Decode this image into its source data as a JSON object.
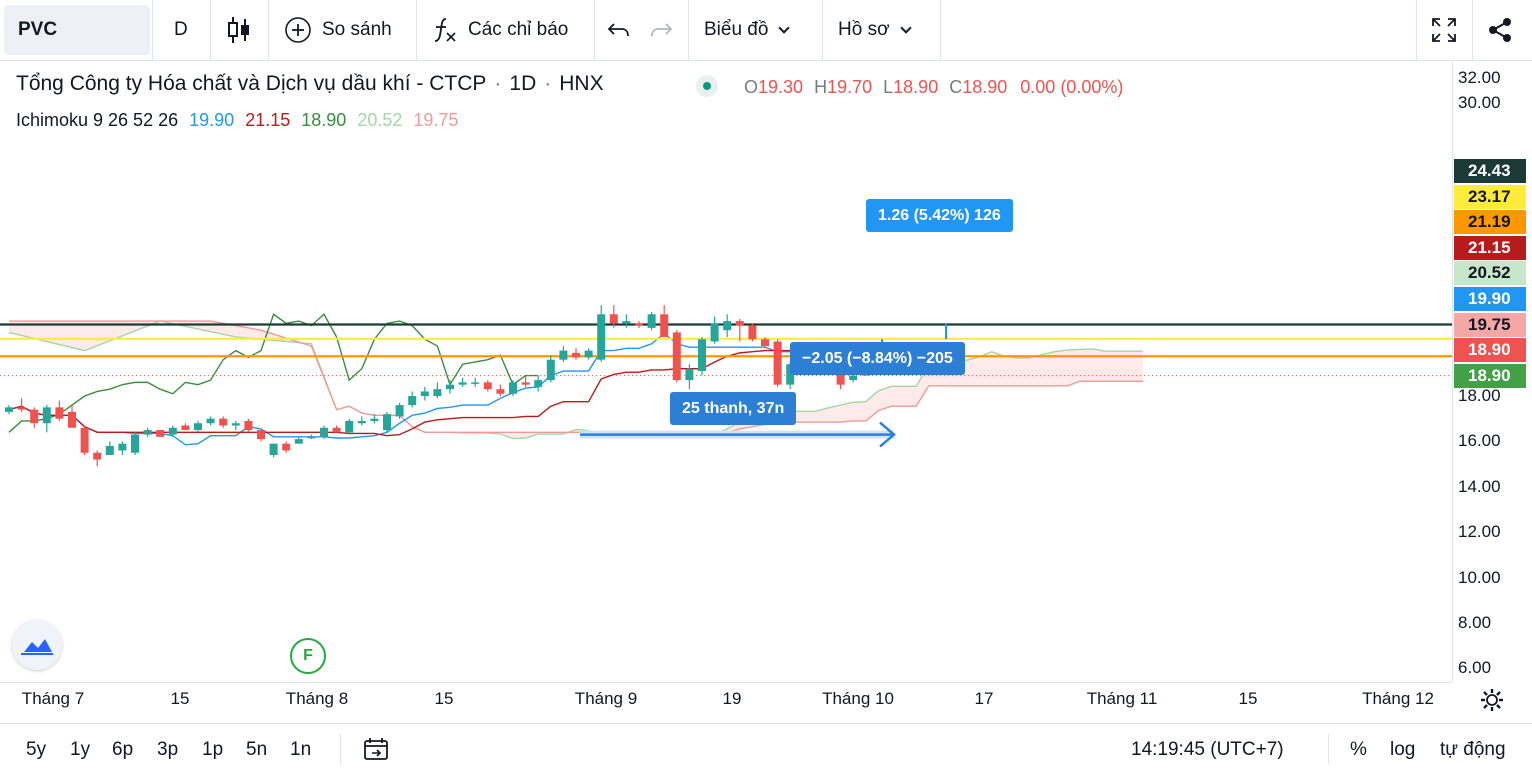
{
  "toolbar": {
    "symbol": "PVC",
    "interval": "D",
    "compare": "So sánh",
    "indicators": "Các chỉ báo",
    "chart_type": "Biểu đồ",
    "profile": "Hồ sơ"
  },
  "header": {
    "title": "Tổng Công ty Hóa chất và Dịch vụ dầu khí - CTCP",
    "interval": "1D",
    "exchange": "HNX",
    "ohlc": {
      "o_label": "O",
      "o": "19.30",
      "h_label": "H",
      "h": "19.70",
      "l_label": "L",
      "l": "18.90",
      "c_label": "C",
      "c": "18.90",
      "change": "0.00 (0.00%)"
    }
  },
  "indicator": {
    "name": "Ichimoku 9 26 52 26",
    "values": [
      "19.90",
      "21.15",
      "18.90",
      "20.52",
      "19.75"
    ],
    "colors": [
      "#2196f3",
      "#b71c1c",
      "#388e3c",
      "#a5d6a7",
      "#ef9a9a"
    ]
  },
  "yaxis": {
    "ticks": [
      "32.00",
      "30.00",
      "18.00",
      "16.00",
      "14.00",
      "12.00",
      "10.00",
      "8.00",
      "6.00"
    ]
  },
  "price_badges": [
    {
      "label": "24.43",
      "bg": "#1b3a36",
      "fg": "#ffffff",
      "value": 24.43
    },
    {
      "label": "23.17",
      "bg": "#ffeb3b",
      "fg": "#131722",
      "value": 23.17
    },
    {
      "label": "21.19",
      "bg": "#ff9800",
      "fg": "#131722",
      "value": 21.19
    },
    {
      "label": "21.15",
      "bg": "#b71c1c",
      "fg": "#ffffff",
      "value": 21.15
    },
    {
      "label": "20.52",
      "bg": "#c8e6c9",
      "fg": "#131722",
      "value": 20.52
    },
    {
      "label": "19.90",
      "bg": "#2196f3",
      "fg": "#ffffff",
      "value": 19.9
    },
    {
      "label": "19.75",
      "bg": "#f4a7a5",
      "fg": "#131722",
      "value": 19.75
    },
    {
      "label": "18.90",
      "bg": "#ef5350",
      "fg": "#ffffff",
      "value": 18.9
    },
    {
      "label": "18.90",
      "bg": "#43a047",
      "fg": "#ffffff",
      "value": 18.9
    }
  ],
  "xaxis": {
    "ticks": [
      "Tháng 7",
      "15",
      "Tháng 8",
      "15",
      "Tháng 9",
      "19",
      "Tháng 10",
      "17",
      "Tháng 11",
      "15",
      "Tháng 12"
    ]
  },
  "drawings": {
    "measure_up": "1.26 (5.42%) 126",
    "measure_down": "−2.05 (−8.84%) −205",
    "bars_range": "25 thanh, 37n",
    "f_marker": "F"
  },
  "bottom": {
    "ranges": [
      "5y",
      "1y",
      "6p",
      "3p",
      "1p",
      "5n",
      "1n"
    ],
    "time": "14:19:45 (UTC+7)",
    "percent": "%",
    "log": "log",
    "auto": "tự động"
  },
  "chart_data": {
    "type": "candlestick",
    "symbol": "PVC",
    "interval": "1D",
    "candles": [
      {
        "date": "2021-06-29",
        "o": 17.3,
        "h": 17.6,
        "l": 17.2,
        "c": 17.5
      },
      {
        "date": "2021-06-30",
        "o": 17.5,
        "h": 17.9,
        "l": 17.3,
        "c": 17.4
      },
      {
        "date": "2021-07-01",
        "o": 17.4,
        "h": 17.5,
        "l": 16.6,
        "c": 16.8
      },
      {
        "date": "2021-07-02",
        "o": 16.8,
        "h": 17.6,
        "l": 16.4,
        "c": 17.5
      },
      {
        "date": "2021-07-05",
        "o": 17.5,
        "h": 17.8,
        "l": 16.9,
        "c": 17.0
      },
      {
        "date": "2021-07-06",
        "o": 17.3,
        "h": 17.6,
        "l": 16.7,
        "c": 16.6
      },
      {
        "date": "2021-07-07",
        "o": 16.6,
        "h": 16.7,
        "l": 15.4,
        "c": 15.5
      },
      {
        "date": "2021-07-08",
        "o": 15.5,
        "h": 15.6,
        "l": 14.9,
        "c": 15.2
      },
      {
        "date": "2021-07-09",
        "o": 15.4,
        "h": 16.0,
        "l": 15.4,
        "c": 15.8
      },
      {
        "date": "2021-07-12",
        "o": 15.6,
        "h": 16.0,
        "l": 15.4,
        "c": 15.9
      },
      {
        "date": "2021-07-13",
        "o": 15.5,
        "h": 16.4,
        "l": 15.4,
        "c": 16.3
      },
      {
        "date": "2021-07-14",
        "o": 16.3,
        "h": 16.6,
        "l": 16.2,
        "c": 16.5
      },
      {
        "date": "2021-07-15",
        "o": 16.5,
        "h": 16.5,
        "l": 16.2,
        "c": 16.2
      },
      {
        "date": "2021-07-16",
        "o": 16.3,
        "h": 16.7,
        "l": 16.2,
        "c": 16.6
      },
      {
        "date": "2021-07-19",
        "o": 16.7,
        "h": 16.8,
        "l": 16.5,
        "c": 16.5
      },
      {
        "date": "2021-07-20",
        "o": 16.5,
        "h": 16.9,
        "l": 16.4,
        "c": 16.8
      },
      {
        "date": "2021-07-21",
        "o": 16.8,
        "h": 17.1,
        "l": 16.7,
        "c": 17.0
      },
      {
        "date": "2021-07-22",
        "o": 17.0,
        "h": 17.1,
        "l": 16.6,
        "c": 16.7
      },
      {
        "date": "2021-07-23",
        "o": 16.7,
        "h": 16.9,
        "l": 16.5,
        "c": 16.8
      },
      {
        "date": "2021-07-26",
        "o": 16.9,
        "h": 17.0,
        "l": 16.4,
        "c": 16.5
      },
      {
        "date": "2021-07-27",
        "o": 16.5,
        "h": 16.5,
        "l": 16.0,
        "c": 16.1
      },
      {
        "date": "2021-07-28",
        "o": 15.4,
        "h": 15.9,
        "l": 15.3,
        "c": 15.9
      },
      {
        "date": "2021-07-29",
        "o": 15.9,
        "h": 16.0,
        "l": 15.5,
        "c": 15.6
      },
      {
        "date": "2021-07-30",
        "o": 15.9,
        "h": 16.2,
        "l": 15.9,
        "c": 16.1
      },
      {
        "date": "2021-08-02",
        "o": 16.2,
        "h": 16.3,
        "l": 16.1,
        "c": 16.2
      },
      {
        "date": "2021-08-03",
        "o": 16.2,
        "h": 16.7,
        "l": 16.1,
        "c": 16.6
      },
      {
        "date": "2021-08-04",
        "o": 16.6,
        "h": 16.7,
        "l": 16.4,
        "c": 16.4
      },
      {
        "date": "2021-08-05",
        "o": 16.4,
        "h": 17.0,
        "l": 16.3,
        "c": 16.9
      },
      {
        "date": "2021-08-06",
        "o": 16.8,
        "h": 17.1,
        "l": 16.7,
        "c": 16.9
      },
      {
        "date": "2021-08-09",
        "o": 16.9,
        "h": 17.2,
        "l": 16.8,
        "c": 17.0
      },
      {
        "date": "2021-08-10",
        "o": 16.5,
        "h": 17.3,
        "l": 16.4,
        "c": 17.2
      },
      {
        "date": "2021-08-11",
        "o": 17.1,
        "h": 17.7,
        "l": 17.0,
        "c": 17.6
      },
      {
        "date": "2021-08-12",
        "o": 17.6,
        "h": 18.2,
        "l": 17.5,
        "c": 18.0
      },
      {
        "date": "2021-08-13",
        "o": 18.0,
        "h": 18.4,
        "l": 17.8,
        "c": 18.2
      },
      {
        "date": "2021-08-16",
        "o": 18.0,
        "h": 18.6,
        "l": 17.9,
        "c": 18.3
      },
      {
        "date": "2021-08-17",
        "o": 18.3,
        "h": 18.7,
        "l": 18.1,
        "c": 18.5
      },
      {
        "date": "2021-08-18",
        "o": 18.5,
        "h": 18.8,
        "l": 18.4,
        "c": 18.6
      },
      {
        "date": "2021-08-19",
        "o": 18.6,
        "h": 18.8,
        "l": 18.4,
        "c": 18.6
      },
      {
        "date": "2021-08-20",
        "o": 18.6,
        "h": 18.7,
        "l": 18.2,
        "c": 18.3
      },
      {
        "date": "2021-08-23",
        "o": 18.3,
        "h": 18.5,
        "l": 18.0,
        "c": 18.1
      },
      {
        "date": "2021-08-24",
        "o": 18.1,
        "h": 18.7,
        "l": 18.0,
        "c": 18.6
      },
      {
        "date": "2021-08-25",
        "o": 18.6,
        "h": 18.9,
        "l": 18.4,
        "c": 18.5
      },
      {
        "date": "2021-08-26",
        "o": 18.4,
        "h": 18.9,
        "l": 18.2,
        "c": 18.7
      },
      {
        "date": "2021-08-27",
        "o": 18.7,
        "h": 19.8,
        "l": 18.6,
        "c": 19.6
      },
      {
        "date": "2021-08-30",
        "o": 19.6,
        "h": 20.2,
        "l": 19.5,
        "c": 20.0
      },
      {
        "date": "2021-08-31",
        "o": 19.9,
        "h": 20.1,
        "l": 19.6,
        "c": 19.7
      },
      {
        "date": "2021-09-01",
        "o": 19.7,
        "h": 20.1,
        "l": 19.6,
        "c": 20.0
      },
      {
        "date": "2021-09-06",
        "o": 19.6,
        "h": 22.0,
        "l": 19.5,
        "c": 21.6
      },
      {
        "date": "2021-09-07",
        "o": 21.6,
        "h": 22.0,
        "l": 21.0,
        "c": 21.2
      },
      {
        "date": "2021-09-08",
        "o": 21.2,
        "h": 21.6,
        "l": 21.0,
        "c": 21.3
      },
      {
        "date": "2021-09-09",
        "o": 21.2,
        "h": 21.3,
        "l": 21.0,
        "c": 21.1
      },
      {
        "date": "2021-09-10",
        "o": 21.0,
        "h": 21.7,
        "l": 20.9,
        "c": 21.6
      },
      {
        "date": "2021-09-13",
        "o": 21.6,
        "h": 22.0,
        "l": 20.6,
        "c": 20.6
      },
      {
        "date": "2021-09-14",
        "o": 20.8,
        "h": 20.9,
        "l": 18.6,
        "c": 18.7
      },
      {
        "date": "2021-09-15",
        "o": 18.7,
        "h": 19.4,
        "l": 18.3,
        "c": 19.2
      },
      {
        "date": "2021-09-16",
        "o": 19.1,
        "h": 20.6,
        "l": 18.9,
        "c": 20.5
      },
      {
        "date": "2021-09-17",
        "o": 20.4,
        "h": 21.5,
        "l": 20.3,
        "c": 21.2
      },
      {
        "date": "2021-09-20",
        "o": 20.9,
        "h": 21.6,
        "l": 20.6,
        "c": 21.3
      },
      {
        "date": "2021-09-21",
        "o": 21.3,
        "h": 21.4,
        "l": 20.4,
        "c": 21.1
      },
      {
        "date": "2021-09-22",
        "o": 21.1,
        "h": 21.2,
        "l": 20.4,
        "c": 20.5
      },
      {
        "date": "2021-09-23",
        "o": 20.5,
        "h": 20.6,
        "l": 20.1,
        "c": 20.2
      },
      {
        "date": "2021-09-24",
        "o": 20.4,
        "h": 20.5,
        "l": 18.4,
        "c": 18.5
      },
      {
        "date": "2021-09-27",
        "o": 18.5,
        "h": 19.5,
        "l": 18.3,
        "c": 19.4
      },
      {
        "date": "2021-09-28",
        "o": 19.3,
        "h": 19.6,
        "l": 19.0,
        "c": 19.5
      },
      {
        "date": "2021-09-29",
        "o": 19.4,
        "h": 19.7,
        "l": 19.2,
        "c": 19.6
      },
      {
        "date": "2021-09-30",
        "o": 19.6,
        "h": 20.3,
        "l": 19.5,
        "c": 19.8
      },
      {
        "date": "2021-10-01",
        "o": 19.5,
        "h": 19.6,
        "l": 18.3,
        "c": 18.5
      },
      {
        "date": "2021-10-04",
        "o": 18.7,
        "h": 19.2,
        "l": 18.6,
        "c": 18.9
      },
      {
        "date": "2021-10-05",
        "o": 19.3,
        "h": 19.7,
        "l": 18.9,
        "c": 18.9
      }
    ],
    "ichimoku": {
      "params": [
        9,
        26,
        52,
        26
      ],
      "conversion_line": {
        "name": "Conversion",
        "color": "#2196f3",
        "last": 19.9
      },
      "base_line": {
        "name": "Base",
        "color": "#b71c1c",
        "last": 21.15
      },
      "lagging_span": {
        "name": "Lagging",
        "color": "#388e3c",
        "last": 18.9
      },
      "leading_span_a": {
        "name": "Lead A",
        "color": "#a5d6a7",
        "last": 20.52
      },
      "leading_span_b": {
        "name": "Lead B",
        "color": "#ef9a9a",
        "last": 19.75
      }
    },
    "horizontal_lines": [
      {
        "value": 21.15,
        "color": "#1b3a36"
      },
      {
        "value": 20.52,
        "color": "#ffeb3b"
      },
      {
        "value": 19.75,
        "color": "#ff9800"
      }
    ],
    "ylim": [
      5.6,
      32.5
    ],
    "y_ticks": [
      32,
      30,
      18,
      16,
      14,
      12,
      10,
      8,
      6
    ],
    "x_ticks": [
      "Tháng 7",
      "15",
      "Tháng 8",
      "15",
      "Tháng 9",
      "19",
      "Tháng 10",
      "17",
      "Tháng 11",
      "15",
      "Tháng 12"
    ],
    "grid": false
  }
}
